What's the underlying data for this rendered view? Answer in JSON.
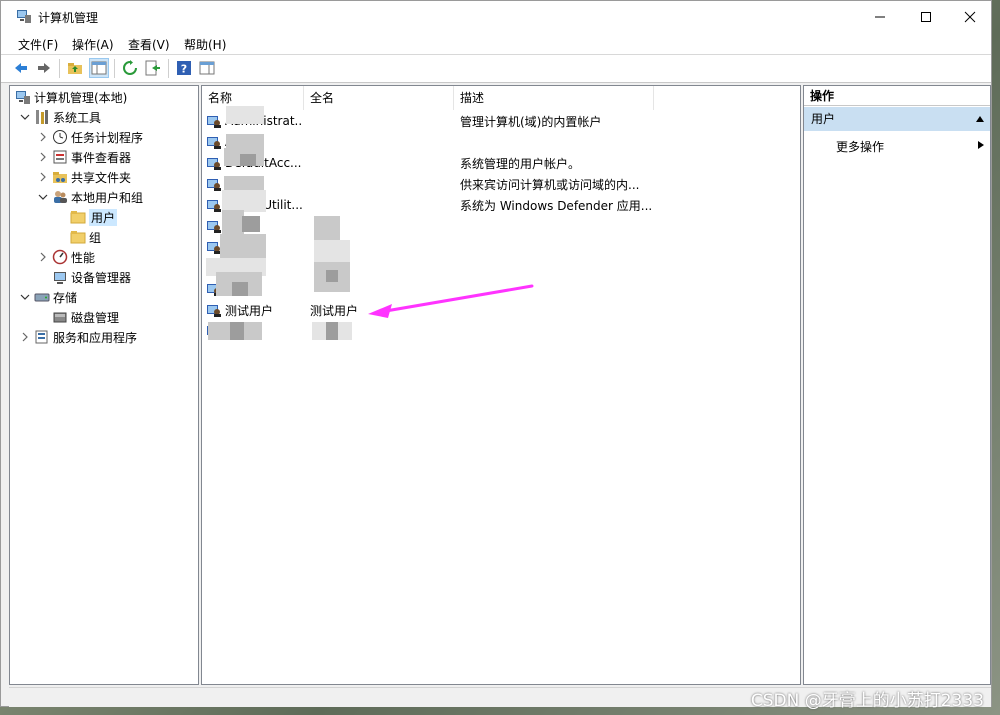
{
  "window": {
    "title": "计算机管理"
  },
  "menu": [
    "文件(F)",
    "操作(A)",
    "查看(V)",
    "帮助(H)"
  ],
  "toolbar": [
    "back",
    "forward",
    "up",
    "show-tree",
    "refresh",
    "export",
    "help",
    "properties"
  ],
  "tree": [
    {
      "label": "计算机管理(本地)",
      "icon": "computer-icon",
      "level": 0,
      "expander": ""
    },
    {
      "label": "系统工具",
      "icon": "tools-icon",
      "level": 1,
      "expander": "v"
    },
    {
      "label": "任务计划程序",
      "icon": "clock-icon",
      "level": 2,
      "expander": ">"
    },
    {
      "label": "事件查看器",
      "icon": "event-viewer-icon",
      "level": 2,
      "expander": ">"
    },
    {
      "label": "共享文件夹",
      "icon": "shared-folder-icon",
      "level": 2,
      "expander": ">"
    },
    {
      "label": "本地用户和组",
      "icon": "users-icon",
      "level": 2,
      "expander": "v"
    },
    {
      "label": "用户",
      "icon": "folder-icon",
      "level": 3,
      "expander": "",
      "selected": true
    },
    {
      "label": "组",
      "icon": "folder-icon",
      "level": 3,
      "expander": ""
    },
    {
      "label": "性能",
      "icon": "performance-icon",
      "level": 2,
      "expander": ">"
    },
    {
      "label": "设备管理器",
      "icon": "device-manager-icon",
      "level": 2,
      "expander": ""
    },
    {
      "label": "存储",
      "icon": "storage-icon",
      "level": 1,
      "expander": "v"
    },
    {
      "label": "磁盘管理",
      "icon": "disk-icon",
      "level": 2,
      "expander": ""
    },
    {
      "label": "服务和应用程序",
      "icon": "services-icon",
      "level": 1,
      "expander": ">"
    }
  ],
  "columns": [
    "名称",
    "全名",
    "描述"
  ],
  "users": [
    {
      "name": "Administrat...",
      "fullname": "",
      "description": "管理计算机(域)的内置帐户"
    },
    {
      "name": "Ad",
      "fullname": "",
      "description": ""
    },
    {
      "name": "DefaultAcc...",
      "fullname": "",
      "description": "系统管理的用户帐户。"
    },
    {
      "name": "",
      "fullname": "",
      "description": "供来宾访问计算机或访问域的内..."
    },
    {
      "name": "WDAGUtilit...",
      "fullname": "",
      "description": "系统为 Windows Defender 应用..."
    },
    {
      "name": "",
      "fullname": "",
      "description": ""
    },
    {
      "name": "",
      "fullname": "",
      "description": ""
    },
    {
      "name": "",
      "fullname": "",
      "description": ""
    },
    {
      "name": "",
      "fullname": "",
      "description": ""
    },
    {
      "name": "测试用户",
      "fullname": "测试用户",
      "description": ""
    },
    {
      "name": "",
      "fullname": "",
      "description": ""
    }
  ],
  "actions": {
    "header": "操作",
    "section": "用户",
    "more": "更多操作"
  },
  "watermark": "CSDN @牙膏上的小苏打2333",
  "colors": {
    "accent": "#cce8ff",
    "action_section": "#c9dff2",
    "arrow": "#ff33ff"
  }
}
